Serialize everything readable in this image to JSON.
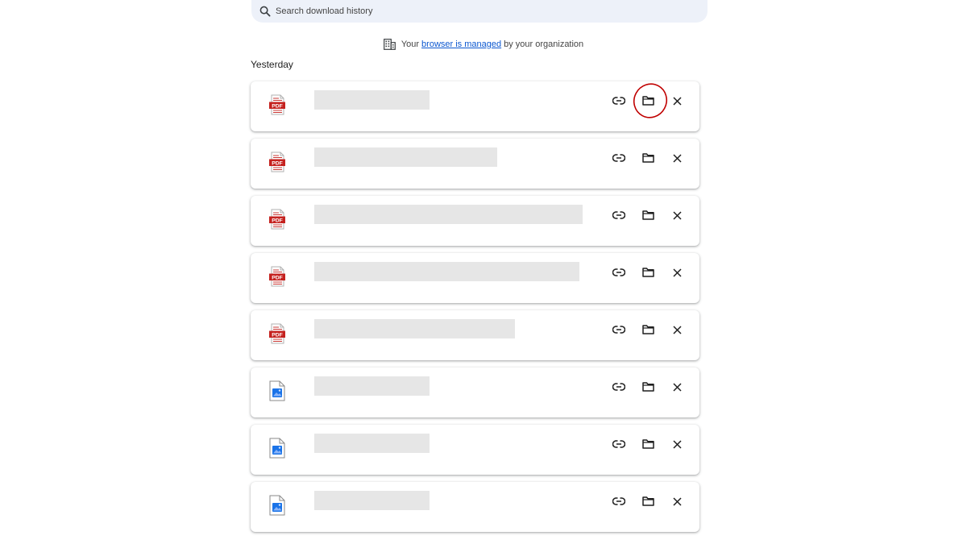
{
  "search": {
    "placeholder": "Search download history"
  },
  "managed_notice": {
    "prefix": "Your",
    "link_text": "browser is managed",
    "suffix": "by your organization"
  },
  "section": {
    "label": "Yesterday"
  },
  "downloads": [
    {
      "type": "pdf",
      "icon_label": "PDF",
      "name_fraction": 0.39
    },
    {
      "type": "pdf",
      "icon_label": "PDF",
      "name_fraction": 0.62
    },
    {
      "type": "pdf",
      "icon_label": "PDF",
      "name_fraction": 0.91
    },
    {
      "type": "pdf",
      "icon_label": "PDF",
      "name_fraction": 0.9
    },
    {
      "type": "pdf",
      "icon_label": "PDF",
      "name_fraction": 0.68
    },
    {
      "type": "image",
      "icon_label": "",
      "name_fraction": 0.39
    },
    {
      "type": "image",
      "icon_label": "",
      "name_fraction": 0.39
    },
    {
      "type": "image",
      "icon_label": "",
      "name_fraction": 0.39
    }
  ],
  "colors": {
    "pdf_red": "#c5221f",
    "image_blue": "#1a73e8",
    "link_blue": "#0b57d0",
    "annotation_red": "#c00000",
    "search_bg": "#edf1f9",
    "placeholder_gray": "#e6e6e6"
  },
  "icons": {
    "search": "search-icon",
    "building": "building-icon",
    "copy_link": "link-icon",
    "show_in_folder": "folder-icon",
    "remove": "close-icon",
    "pdf_file": "pdf-file-icon",
    "image_file": "image-file-icon"
  }
}
